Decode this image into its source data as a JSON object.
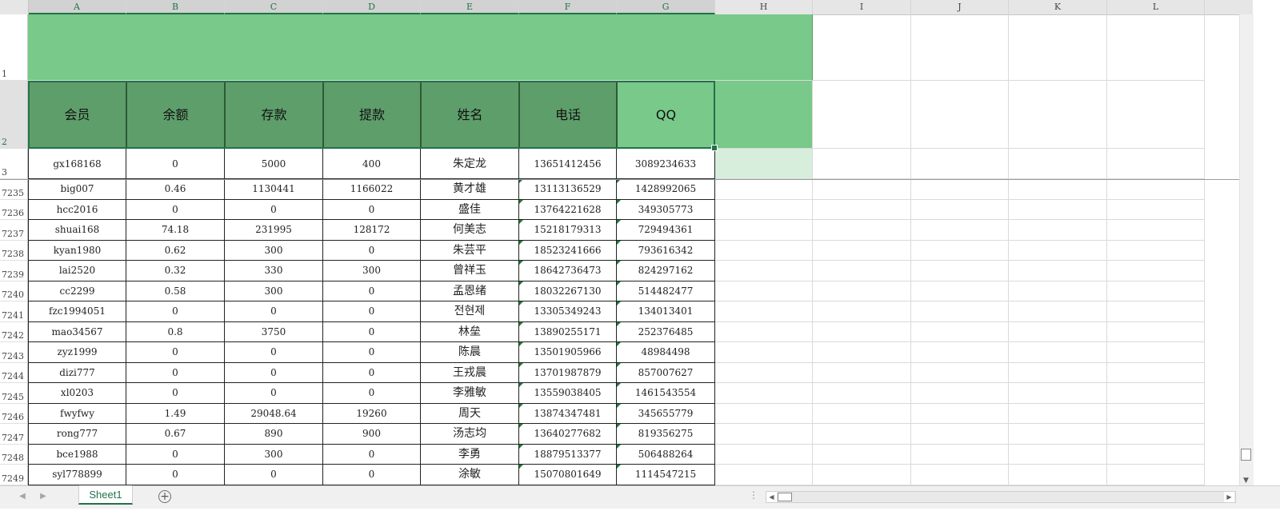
{
  "columns": [
    "A",
    "B",
    "C",
    "D",
    "E",
    "F",
    "G",
    "H",
    "I",
    "J",
    "K",
    "L"
  ],
  "row_numbers": [
    "1",
    "2",
    "3",
    "7235",
    "7236",
    "7237",
    "7238",
    "7239",
    "7240",
    "7241",
    "7242",
    "7243",
    "7244",
    "7245",
    "7246",
    "7247",
    "7248",
    "7249"
  ],
  "headers": [
    "会员",
    "余额",
    "存款",
    "提款",
    "姓名",
    "电话",
    "QQ"
  ],
  "rows": [
    [
      "gx168168",
      "0",
      "5000",
      "400",
      "朱定龙",
      "13651412456",
      "3089234633"
    ],
    [
      "big007",
      "0.46",
      "1130441",
      "1166022",
      "黄才雄",
      "13113136529",
      "1428992065"
    ],
    [
      "hcc2016",
      "0",
      "0",
      "0",
      "盛佳",
      "13764221628",
      "349305773"
    ],
    [
      "shuai168",
      "74.18",
      "231995",
      "128172",
      "何美志",
      "15218179313",
      "729494361"
    ],
    [
      "kyan1980",
      "0.62",
      "300",
      "0",
      "朱芸平",
      "18523241666",
      "793616342"
    ],
    [
      "lai2520",
      "0.32",
      "330",
      "300",
      "曾祥玉",
      "18642736473",
      "824297162"
    ],
    [
      "cc2299",
      "0.58",
      "300",
      "0",
      "孟恩绪",
      "18032267130",
      "514482477"
    ],
    [
      "fzc1994051",
      "0",
      "0",
      "0",
      "전현제",
      "13305349243",
      "134013401"
    ],
    [
      "mao34567",
      "0.8",
      "3750",
      "0",
      "林垒",
      "13890255171",
      "252376485"
    ],
    [
      "zyz1999",
      "0",
      "0",
      "0",
      "陈晨",
      "13501905966",
      "48984498"
    ],
    [
      "dizi777",
      "0",
      "0",
      "0",
      "王戎晨",
      "13701987879",
      "857007627"
    ],
    [
      "xl0203",
      "0",
      "0",
      "0",
      "李雅敏",
      "13559038405",
      "1461543554"
    ],
    [
      "fwyfwy",
      "1.49",
      "29048.64",
      "19260",
      "周天",
      "13874347481",
      "345655779"
    ],
    [
      "rong777",
      "0.67",
      "890",
      "900",
      "汤志均",
      "13640277682",
      "819356275"
    ],
    [
      "bce1988",
      "0",
      "300",
      "0",
      "李勇",
      "18879513377",
      "506488264"
    ],
    [
      "syl778899",
      "0",
      "0",
      "0",
      "涂敏",
      "15070801649",
      "1114547215"
    ]
  ],
  "sheet_tab": "Sheet1",
  "colors": {
    "title_band": "#78c98a",
    "header_dark": "#5e9e6b",
    "header_light": "#78c98a",
    "selected_cell": "#d6eedb",
    "accent": "#217346"
  },
  "icons": [
    "add-sheet-icon",
    "scroll-left-icon",
    "scroll-right-icon",
    "scroll-down-icon",
    "sheet-nav-prev-icon",
    "sheet-nav-next-icon"
  ]
}
